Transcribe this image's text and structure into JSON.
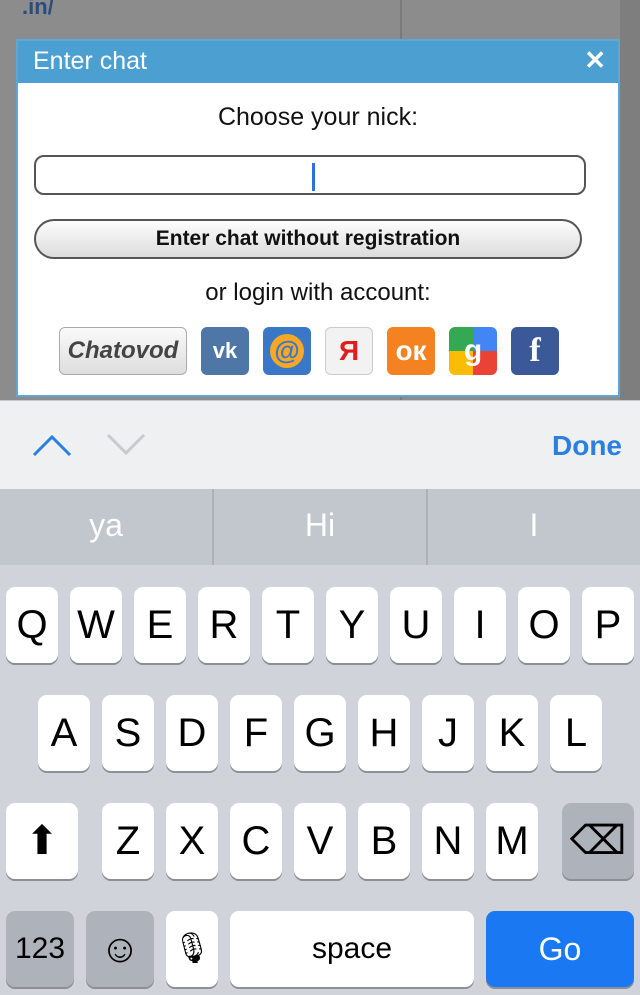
{
  "background": {
    "link_text": ".in/"
  },
  "dialog": {
    "title": "Enter chat",
    "close_label": "✕",
    "nick_label": "Choose your nick:",
    "nick_value": "",
    "enter_button": "Enter chat without registration",
    "or_login": "or login with account:",
    "providers": {
      "chatovod": "Chatovod",
      "vk": "vk",
      "mail": "@",
      "yandex": "Я",
      "ok": "ок",
      "google": "g",
      "facebook": "f"
    }
  },
  "accessory": {
    "done_label": "Done"
  },
  "keyboard": {
    "predictions": [
      "ya",
      "Hi",
      "I"
    ],
    "row1": [
      "Q",
      "W",
      "E",
      "R",
      "T",
      "Y",
      "U",
      "I",
      "O",
      "P"
    ],
    "row2": [
      "A",
      "S",
      "D",
      "F",
      "G",
      "H",
      "J",
      "K",
      "L"
    ],
    "row3": [
      "Z",
      "X",
      "C",
      "V",
      "B",
      "N",
      "M"
    ],
    "numbers_label": "123",
    "emoji_label": "☺",
    "mic_label": "🎙",
    "space_label": "space",
    "go_label": "Go",
    "shift_label": "⬆",
    "backspace_label": "⌫"
  },
  "colors": {
    "header": "#4b9fd1",
    "done": "#2a7fe0",
    "go": "#1a79f2"
  }
}
